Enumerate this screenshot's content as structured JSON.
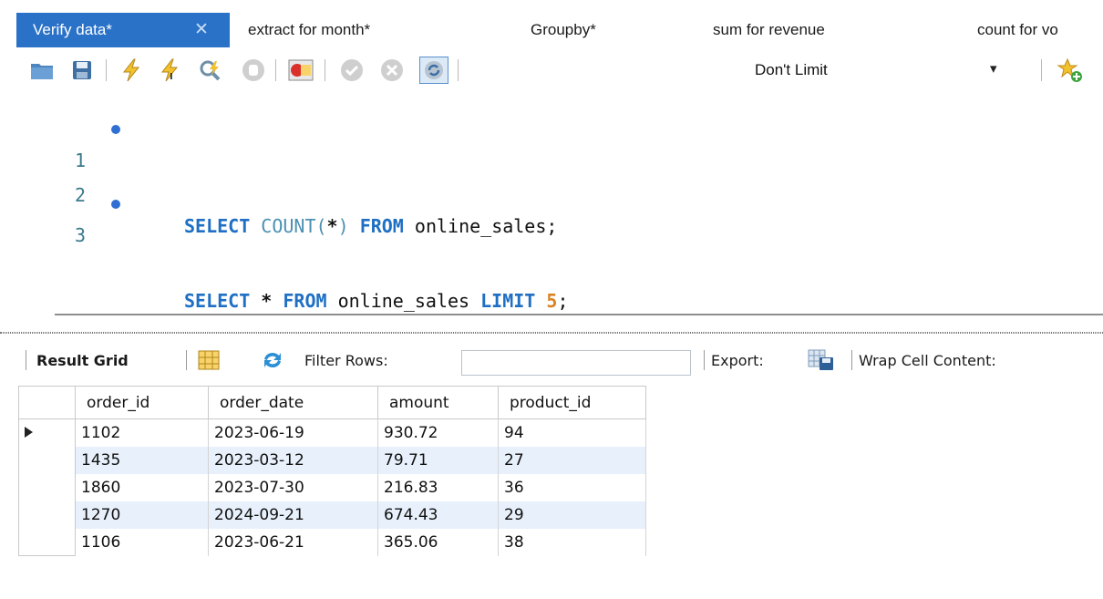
{
  "tabs": [
    {
      "label": "Verify data*",
      "active": true,
      "close": "✕"
    },
    {
      "label": "extract for  month*",
      "active": false
    },
    {
      "label": "Groupby*",
      "active": false
    },
    {
      "label": "sum for revenue",
      "active": false
    },
    {
      "label": "count for vo",
      "active": false
    }
  ],
  "toolbar": {
    "limit": {
      "selected": "Don't Limit"
    },
    "icons": [
      "open-folder-icon",
      "save-icon",
      "execute-icon",
      "execute-current-icon",
      "explain-icon",
      "stop-icon",
      "toggle-error-icon",
      "commit-icon",
      "rollback-icon",
      "autocommit-icon",
      "add-snippet-icon"
    ]
  },
  "editor": {
    "lines": [
      {
        "number": "1",
        "has_marker": true,
        "sql": "SELECT COUNT(*) FROM online_sales;"
      },
      {
        "number": "2",
        "has_marker": false,
        "sql": ""
      },
      {
        "number": "3",
        "has_marker": true,
        "sql": "SELECT * FROM online_sales LIMIT 5;"
      }
    ],
    "tokens": {
      "l1": {
        "kw1": "SELECT",
        "fn": "COUNT(",
        "star": "*",
        "close": ")",
        "kw2": "FROM",
        "rest": " online_sales;"
      },
      "l3": {
        "kw1": "SELECT",
        "star": "*",
        "kw2": "FROM",
        "mid": " online_sales ",
        "kw3": "LIMIT",
        "num": "5",
        "end": ";"
      }
    }
  },
  "result_toolbar": {
    "result_grid": "Result Grid",
    "filter_rows": "Filter Rows:",
    "filter_value": "",
    "export": "Export:",
    "wrap": "Wrap Cell Content:"
  },
  "result": {
    "columns": [
      "order_id",
      "order_date",
      "amount",
      "product_id"
    ],
    "rows": [
      [
        "1102",
        "2023-06-19",
        "930.72",
        "94"
      ],
      [
        "1435",
        "2023-03-12",
        "79.71",
        "27"
      ],
      [
        "1860",
        "2023-07-30",
        "216.83",
        "36"
      ],
      [
        "1270",
        "2024-09-21",
        "674.43",
        "29"
      ],
      [
        "1106",
        "2023-06-21",
        "365.06",
        "38"
      ]
    ]
  },
  "colors": {
    "active_tab": "#2a72c8",
    "keyword": "#1f6fc4",
    "number": "#d98324",
    "alt_row": "#e8f0fb"
  }
}
